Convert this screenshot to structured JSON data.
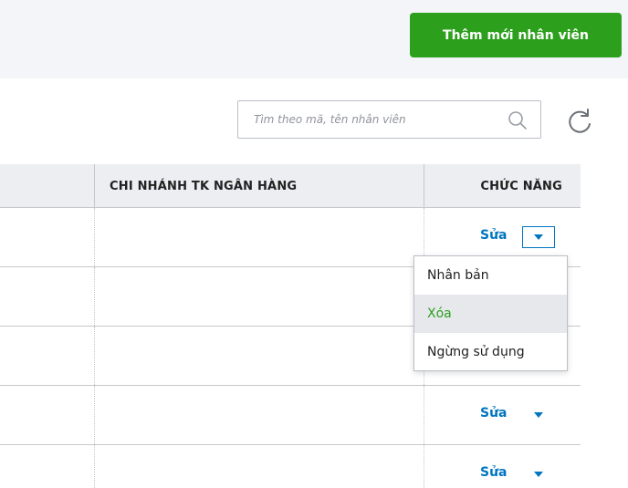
{
  "toolbar": {
    "add_label": "Thêm mới nhân viên"
  },
  "search": {
    "placeholder": "Tìm theo mã, tên nhân viên"
  },
  "table": {
    "headers": {
      "bank_branch": "CHI NHÁNH TK NGÂN HÀNG",
      "functions": "CHỨC NĂNG"
    },
    "rows": [
      {
        "edit": "Sửa"
      },
      {
        "edit": ""
      },
      {
        "edit": ""
      },
      {
        "edit": "Sửa"
      },
      {
        "edit": "Sửa"
      }
    ]
  },
  "menu": {
    "items": [
      {
        "label": "Nhân bản"
      },
      {
        "label": "Xóa"
      },
      {
        "label": "Ngừng sử dụng"
      }
    ]
  },
  "colors": {
    "primary_green": "#2ca01c",
    "link_blue": "#0075c0",
    "header_bg": "#eceef1"
  },
  "icons": [
    "search-icon",
    "refresh-icon",
    "chevron-down-icon"
  ]
}
